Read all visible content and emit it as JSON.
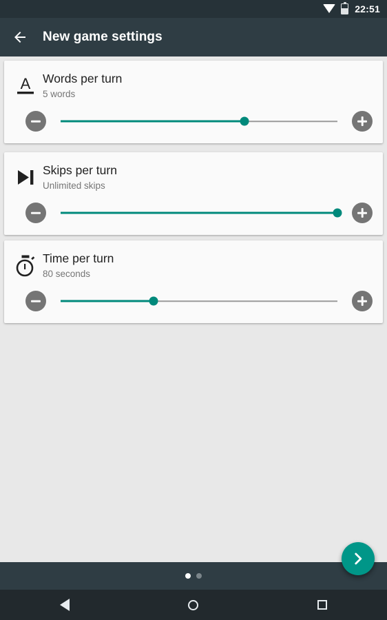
{
  "status_bar": {
    "time": "22:51",
    "wifi_icon": "wifi-icon",
    "battery_icon": "battery-icon"
  },
  "app_bar": {
    "back_icon": "arrow-back-icon",
    "title": "New game settings"
  },
  "colors": {
    "accent_teal": "#009688",
    "slider_teal": "#00897b",
    "app_bar": "#2f3d44",
    "status_bar": "#263238",
    "background": "#e8e8e8",
    "card": "#fafafa",
    "title_text": "#212121",
    "subtitle_text": "#757575",
    "stepper_button": "#757575",
    "nav_bar": "#22292d"
  },
  "settings_cards": [
    {
      "icon": "font-size-icon",
      "title": "Words per turn",
      "subtitle": "5 words",
      "decrement_label": "−",
      "increment_label": "+",
      "slider_percent": 66.5
    },
    {
      "icon": "skip-next-icon",
      "title": "Skips per turn",
      "subtitle": "Unlimited skips",
      "decrement_label": "−",
      "increment_label": "+",
      "slider_percent": 100
    },
    {
      "icon": "stopwatch-icon",
      "title": "Time per turn",
      "subtitle": "80 seconds",
      "decrement_label": "−",
      "increment_label": "+",
      "slider_percent": 33.5
    }
  ],
  "fab": {
    "icon": "chevron-right-icon",
    "label": "Next"
  },
  "pager": {
    "total_pages": 2,
    "current_page": 1
  },
  "nav_bar": {
    "back_icon": "nav-back-icon",
    "home_icon": "nav-home-icon",
    "recents_icon": "nav-recents-icon"
  }
}
